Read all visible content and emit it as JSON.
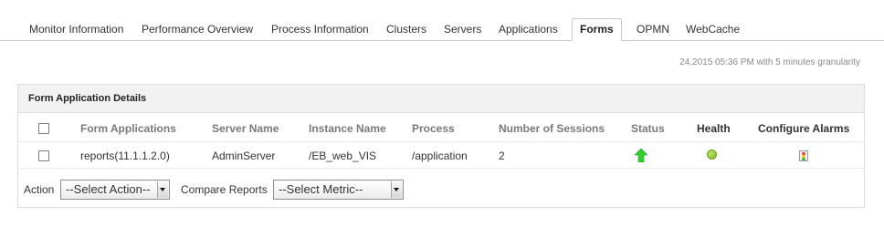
{
  "tabs": [
    {
      "label": "Monitor Information"
    },
    {
      "label": "Performance Overview"
    },
    {
      "label": "Process Information"
    },
    {
      "label": "Clusters"
    },
    {
      "label": "Servers"
    },
    {
      "label": "Applications"
    },
    {
      "label": "Forms",
      "active": true
    },
    {
      "label": "OPMN"
    },
    {
      "label": "WebCache"
    }
  ],
  "time_info": "24,2015 05:36 PM with 5 minutes granularity",
  "panel": {
    "title": "Form Application Details",
    "columns": [
      "Form Applications",
      "Server Name",
      "Instance Name",
      "Process",
      "Number of Sessions",
      "Status",
      "Health",
      "Configure Alarms"
    ],
    "rows": [
      {
        "application": "reports(11.1.1.2.0)",
        "server": "AdminServer",
        "instance": "/EB_web_VIS",
        "process": "/application",
        "sessions": "2",
        "status_icon": "up-arrow-icon",
        "health_icon": "health-dot-icon",
        "alarm_icon": "traffic-light-icon"
      }
    ]
  },
  "footer": {
    "action_label": "Action",
    "action_select": "--Select Action--",
    "compare_label": "Compare Reports",
    "metric_select": "--Select Metric--"
  },
  "colors": {
    "status_up": "#33cc33",
    "health_good": "#8fc23a",
    "tab_border": "#c9c9c9",
    "panel_header_bg": "#f2f2f2"
  }
}
